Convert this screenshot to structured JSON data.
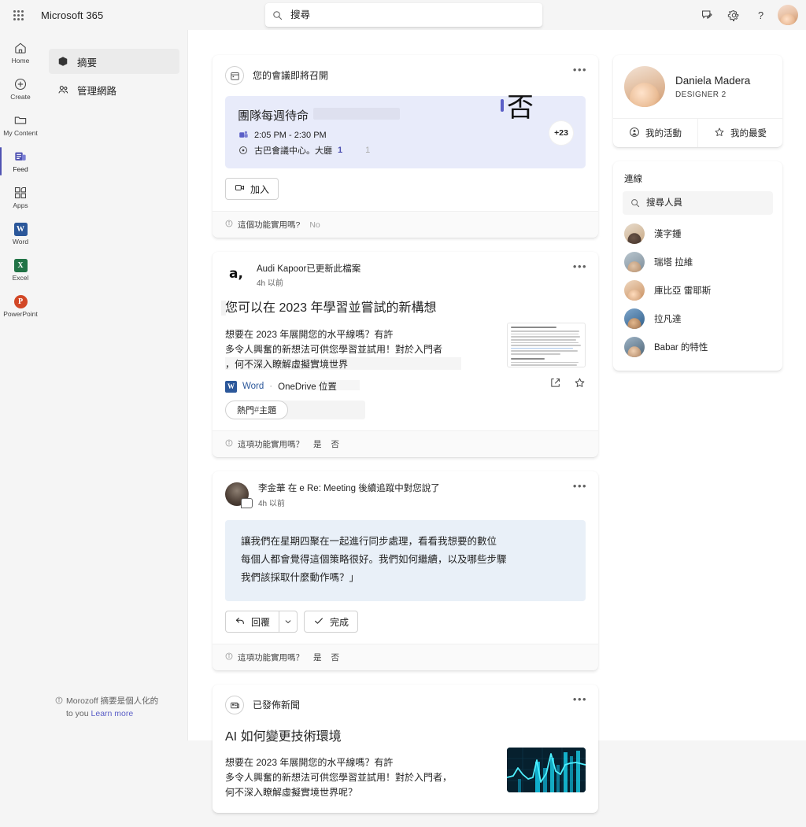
{
  "app": {
    "brand": "Microsoft 365",
    "waffle_icon": "app-launcher-icon"
  },
  "search": {
    "placeholder": "搜尋",
    "value": "",
    "icon": "search-icon"
  },
  "topbar_actions": [
    {
      "name": "feedback-icon",
      "label": "意見反應"
    },
    {
      "name": "settings-gear-icon",
      "label": "設定"
    },
    {
      "name": "help-icon",
      "label": "?"
    }
  ],
  "rail": [
    {
      "id": "home",
      "label": "Home",
      "icon": "home-icon",
      "active": false
    },
    {
      "id": "create",
      "label": "Create",
      "icon": "plus-circle-icon",
      "active": false
    },
    {
      "id": "my-content",
      "label": "My Content",
      "icon": "folder-icon",
      "active": false
    },
    {
      "id": "feed",
      "label": "Feed",
      "icon": "feed-icon",
      "active": true
    },
    {
      "id": "apps",
      "label": "Apps",
      "icon": "apps-grid-icon",
      "active": false
    },
    {
      "id": "word",
      "label": "Word",
      "icon": "word-icon",
      "active": false,
      "color": "#2b579a",
      "glyph": "W"
    },
    {
      "id": "excel",
      "label": "Excel",
      "icon": "excel-icon",
      "active": false,
      "color": "#217346",
      "glyph": "X"
    },
    {
      "id": "powerpoint",
      "label": "PowerPoint",
      "icon": "powerpoint-icon",
      "active": false,
      "color": "#d24726",
      "glyph": "P"
    }
  ],
  "leftnav": {
    "items": [
      {
        "id": "summary",
        "label": "摘要",
        "icon": "cube-icon",
        "selected": true
      },
      {
        "id": "manage-network",
        "label": "管理網路",
        "icon": "people-icon",
        "selected": false
      }
    ],
    "footer": {
      "prefix": "Morozoff 摘要是個人化的",
      "suffix": "to you",
      "link": "Learn more",
      "icon": "info-icon"
    }
  },
  "feed": {
    "meeting_card": {
      "header_icon": "calendar-icon",
      "header_title": "您的會議即將召開",
      "more_icon": "more-options-icon",
      "title": "團隊每週待命",
      "time": "2:05 PM - 2:30 PM",
      "time_icon": "teams-icon",
      "location": "古巴會議中心。大廳",
      "location_num": "1",
      "location_faint": "1",
      "location_icon": "location-pin-icon",
      "rsvp_glyph": "否",
      "attendee_overflow": "+23",
      "join_button": "加入",
      "join_icon": "video-camera-icon",
      "feedback_question": "這個功能實用嗎?",
      "feedback_options": [
        "No"
      ]
    },
    "doc_card": {
      "avatar_initials": "a,",
      "actor": "Audi Kapoor",
      "action": "已更新此檔案",
      "timestamp": "4h 以前",
      "more_icon": "more-options-icon",
      "title": "您可以在 2023 年學習並嘗試的新構想",
      "summary_lines": [
        "想要在 2023 年展開您的水平線嗎？有許",
        "多令人興奮的新想法可供您學習並試用！對於入門者",
        "，何不深入瞭解虛擬實境世界"
      ],
      "app_name": "Word",
      "app_icon": "word-icon",
      "separator": "·",
      "location": "OneDrive 位置",
      "share_icon": "share-icon",
      "favorite_icon": "star-icon",
      "tag_prefix": "熱門 ",
      "tag_hash": "#",
      "tag_text": "主題",
      "feedback_question": "這項功能實用嗎？",
      "feedback_options": [
        "是",
        "否"
      ]
    },
    "mention_card": {
      "actor": "李金華",
      "action_pre": "在",
      "thread": "e Re: Meeting",
      "action_post": "後續追蹤中對您說了",
      "timestamp": "4h 以前",
      "avatar_icon": "person-avatar",
      "badge_icon": "chat-bubble-icon",
      "more_icon": "more-options-icon",
      "quote_lines": [
        "讓我們在星期四聚在一起進行同步處理，看看我想要的數位",
        "每個人都會覺得這個策略很好。我們如何繼續，以及哪些步驟",
        "我們該採取什麼動作嗎？」"
      ],
      "reply_button": "回覆",
      "reply_icon": "reply-arrow-icon",
      "reply_caret_icon": "chevron-down-icon",
      "done_button": "完成",
      "done_icon": "checkmark-icon",
      "feedback_question": "這項功能實用嗎？",
      "feedback_options": [
        "是",
        "否"
      ]
    },
    "news_card": {
      "header_icon": "news-icon",
      "header_title": "已發佈新聞",
      "more_icon": "more-options-icon",
      "title": "AI 如何變更技術環境",
      "summary_lines": [
        "想要在 2023 年展開您的水平線嗎？有許",
        "多令人興奮的新想法可供您學習並試用！對於入門者，",
        "何不深入瞭解虛擬實境世界呢？"
      ],
      "thumbnail": "data-chart-image"
    }
  },
  "profile": {
    "name": "Daniela Madera",
    "role": "DESIGNER 2",
    "avatar_icon": "user-avatar",
    "actions": [
      {
        "id": "my-activity",
        "label": "我的活動",
        "icon": "activity-person-icon"
      },
      {
        "id": "my-favorites",
        "label": "我的最愛",
        "icon": "star-icon"
      }
    ]
  },
  "connections": {
    "title": "連線",
    "search_placeholder": "搜尋人員",
    "search_value": "",
    "search_icon": "search-icon",
    "people": [
      {
        "name": "漢字鍾",
        "avatar": "person-avatar-1",
        "c1": "#4a3b33",
        "c2": "#c79b78"
      },
      {
        "name": "瑞塔 拉維",
        "avatar": "person-avatar-2",
        "c1": "#60707d",
        "c2": "#cfb49c"
      },
      {
        "name": "庫比亞 雷耶斯",
        "avatar": "person-avatar-3",
        "c1": "#7d5236",
        "c2": "#e3b48c"
      },
      {
        "name": "拉凡達",
        "avatar": "person-avatar-4",
        "c1": "#2f4a6b",
        "c2": "#d0a37c"
      },
      {
        "name": "Babar 的特性",
        "avatar": "person-avatar-5",
        "c1": "#46586b",
        "c2": "#d8b08c"
      }
    ]
  },
  "colors": {
    "accent": "#4f52b2",
    "link": "#5b5fc7",
    "meeting_bg": "#e8ebfa",
    "quote_bg": "#e9f0f8",
    "word_blue": "#2b579a"
  }
}
